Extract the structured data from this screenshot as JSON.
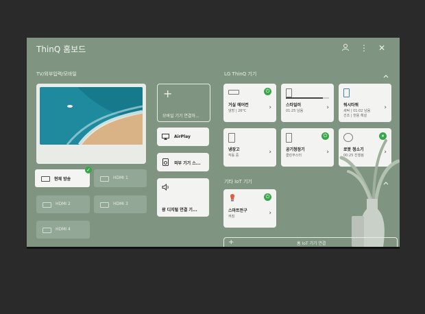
{
  "header": {
    "title": "ThinQ 홈보드",
    "icons": [
      "user-icon",
      "more-vert-icon",
      "close-icon"
    ]
  },
  "sections": {
    "tv": "TV/외부입력/모바일",
    "lg": "LG ThinQ 기기",
    "other": "기타 IoT 기기"
  },
  "sources": [
    {
      "label": "현재 방송",
      "active": true
    },
    {
      "label": "HDMI 1",
      "active": false
    },
    {
      "label": "HDMI 2",
      "active": false
    },
    {
      "label": "HDMI 3",
      "active": false
    },
    {
      "label": "HDMI 4",
      "active": false
    }
  ],
  "mobile": {
    "connect": "모바일 기기 연결하...",
    "airplay": "AirPlay",
    "external": "외부 기기 스...",
    "optical": "광 디지털 연결 기..."
  },
  "devices": [
    {
      "name": "거실 에어컨",
      "status": "냉방 | 26°C",
      "icon": "air-conditioner-icon",
      "power": true
    },
    {
      "name": "스타일러",
      "status": "01:25 남음",
      "icon": "styler-icon",
      "progress": 0.85
    },
    {
      "name": "워시타워",
      "status": "세탁 | 01:02 남음",
      "status2": "건조 | 헌용 헤설",
      "icon": "washtower-icon"
    },
    {
      "name": "냉장고",
      "status": "작동 중",
      "icon": "refrigerator-icon"
    },
    {
      "name": "공기청정기",
      "status": "클린부스터",
      "icon": "air-purifier-icon",
      "power": true
    },
    {
      "name": "로봇 청소기",
      "status": "00:25 진행됨",
      "icon": "robot-cleaner-icon",
      "power": true
    }
  ],
  "iot": [
    {
      "name": "스마트전구",
      "status": "켜짐",
      "icon": "bulb-icon",
      "power": true
    }
  ],
  "footer": {
    "add_iot": "홈 IoT 기기 연결"
  }
}
